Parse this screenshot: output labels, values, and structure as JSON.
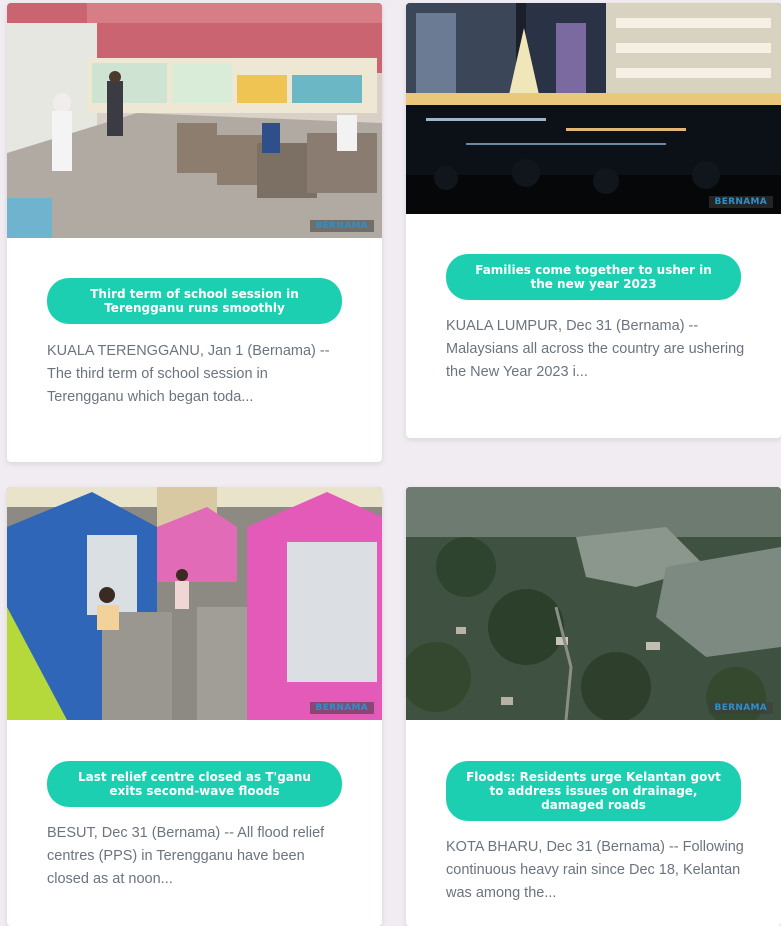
{
  "cards": [
    {
      "title": "Third term of school session in Terengganu runs smoothly",
      "excerpt": "KUALA TERENGGANU, Jan 1 (Bernama) -- The third term of school session in Terengganu which began toda...",
      "watermark": "BERNAMA",
      "image_subject": "classroom-photo"
    },
    {
      "title": "Families come together to usher in the new year 2023",
      "excerpt": "KUALA LUMPUR, Dec 31 (Bernama) -- Malaysians all across the country are ushering the New Year 2023 i...",
      "watermark": "BERNAMA",
      "image_subject": "new-year-night-photo"
    },
    {
      "title": "Last relief centre closed as T'ganu exits second-wave floods",
      "excerpt": "BESUT, Dec 31 (Bernama) -- All flood relief centres (PPS) in Terengganu have been closed as at noon...",
      "watermark": "BERNAMA",
      "image_subject": "relief-centre-tents-photo"
    },
    {
      "title": "Floods: Residents urge Kelantan govt to address issues on drainage, damaged roads",
      "excerpt": "KOTA BHARU, Dec 31 (Bernama) -- Following continuous heavy rain since Dec 18, Kelantan was among the...",
      "watermark": "BERNAMA",
      "image_subject": "aerial-flood-photo"
    }
  ],
  "colors": {
    "accent": "#1ccfb0",
    "page_bg": "#f1ecf2",
    "excerpt_text": "#6b7480"
  }
}
